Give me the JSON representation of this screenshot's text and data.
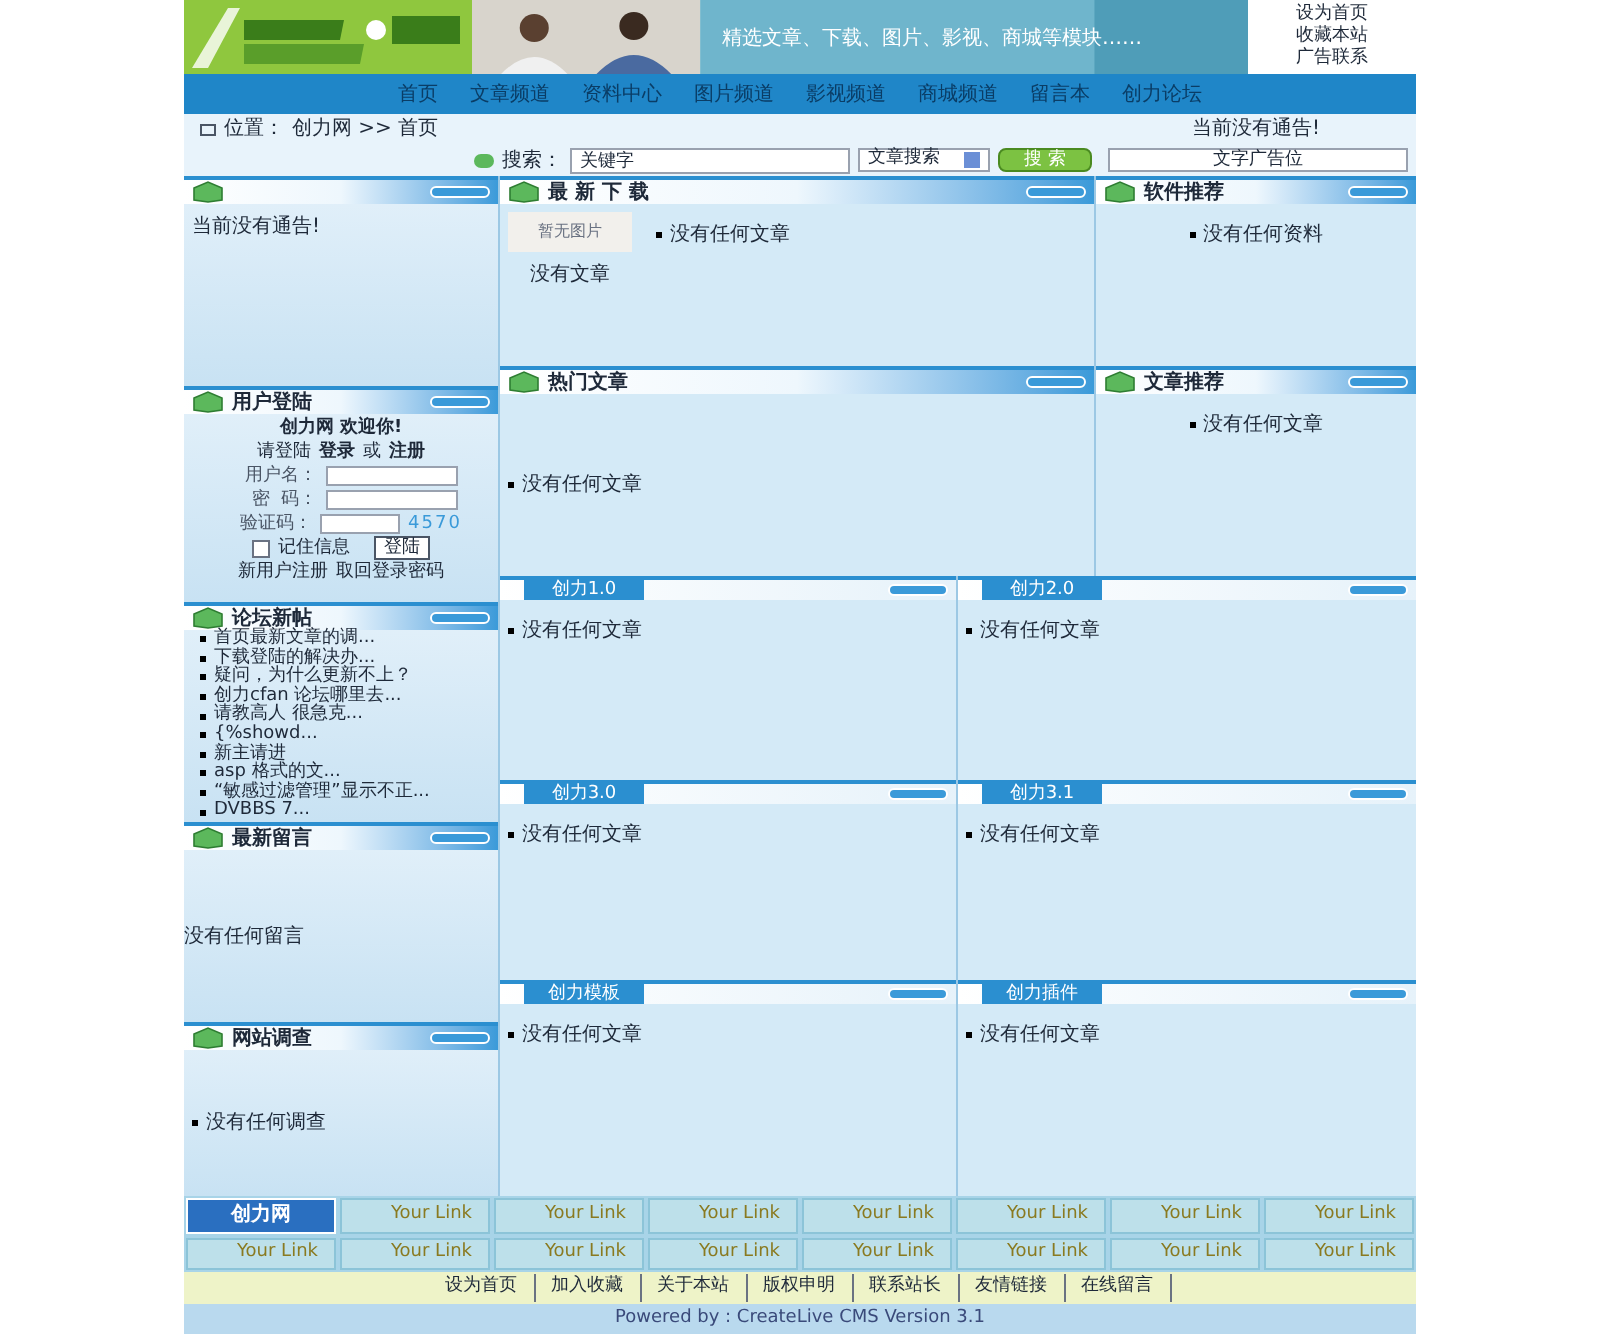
{
  "header": {
    "slogan": "精选文章、下载、图片、影视、商城等模块……",
    "links": [
      "设为首页",
      "收藏本站",
      "广告联系"
    ]
  },
  "nav": [
    "首页",
    "文章频道",
    "资料中心",
    "图片频道",
    "影视频道",
    "商城频道",
    "留言本",
    "创力论坛"
  ],
  "location": {
    "label": "位置：",
    "path": "创力网 >> 首页",
    "notice": "当前没有通告!"
  },
  "search": {
    "label": "搜索：",
    "value": "关键字",
    "scope": "文章搜索",
    "button": "搜 索",
    "ad": "文字广告位"
  },
  "left": [
    {
      "kind": "notice",
      "text": "当前没有通告!"
    },
    {
      "kind": "login",
      "title": "用户登陆",
      "welcome": "创力网 欢迎你!",
      "prompt": "请登陆",
      "login_link": "登录",
      "or": "或",
      "register_link": "注册",
      "fields": [
        "用户名：",
        "密  码：",
        "验证码："
      ],
      "captcha": "4570",
      "remember": "记住信息",
      "remember_checked": false,
      "button": "登陆",
      "links": [
        "新用户注册",
        "取回登录密码"
      ]
    },
    {
      "kind": "list",
      "title": "论坛新帖",
      "items": [
        "首页最新文章的调...",
        "下载登陆的解决办...",
        "疑问，为什么更新不上？",
        "创力cfan 论坛哪里去...",
        "请教高人 很急克...",
        "{%showd...",
        "新主请进",
        "asp 格式的文...",
        "“敏感过滤管理”显示不正...",
        "DVBBS 7..."
      ]
    },
    {
      "kind": "text",
      "title": "最新留言",
      "text": "没有任何留言"
    },
    {
      "kind": "bullet",
      "title": "网站调查",
      "text": "没有任何调查"
    }
  ],
  "downloads": {
    "title": "最 新 下 载",
    "thumb": "暂无图片",
    "thumb_caption": "没有文章",
    "item": "没有任何文章"
  },
  "hot": {
    "title": "热门文章",
    "item": "没有任何文章"
  },
  "right": [
    {
      "title": "软件推荐",
      "item": "没有任何资料"
    },
    {
      "title": "文章推荐",
      "item": "没有任何文章"
    }
  ],
  "categories": [
    {
      "title": "创力1.0",
      "item": "没有任何文章"
    },
    {
      "title": "创力2.0",
      "item": "没有任何文章"
    },
    {
      "title": "创力3.0",
      "item": "没有任何文章"
    },
    {
      "title": "创力3.1",
      "item": "没有任何文章"
    },
    {
      "title": "创力模板",
      "item": "没有任何文章"
    },
    {
      "title": "创力插件",
      "item": "没有任何文章"
    }
  ],
  "friend_links": {
    "logo": "创力网",
    "items": [
      "Your Link",
      "Your Link",
      "Your Link",
      "Your Link",
      "Your Link",
      "Your Link",
      "Your Link",
      "Your Link",
      "Your Link",
      "Your Link",
      "Your Link",
      "Your Link",
      "Your Link",
      "Your Link",
      "Your Link"
    ]
  },
  "footer": {
    "links": [
      "设为首页",
      "加入收藏",
      "关于本站",
      "版权申明",
      "联系站长",
      "友情链接",
      "在线留言"
    ],
    "powered": "Powered by : CreateLive CMS Version 3.1"
  }
}
